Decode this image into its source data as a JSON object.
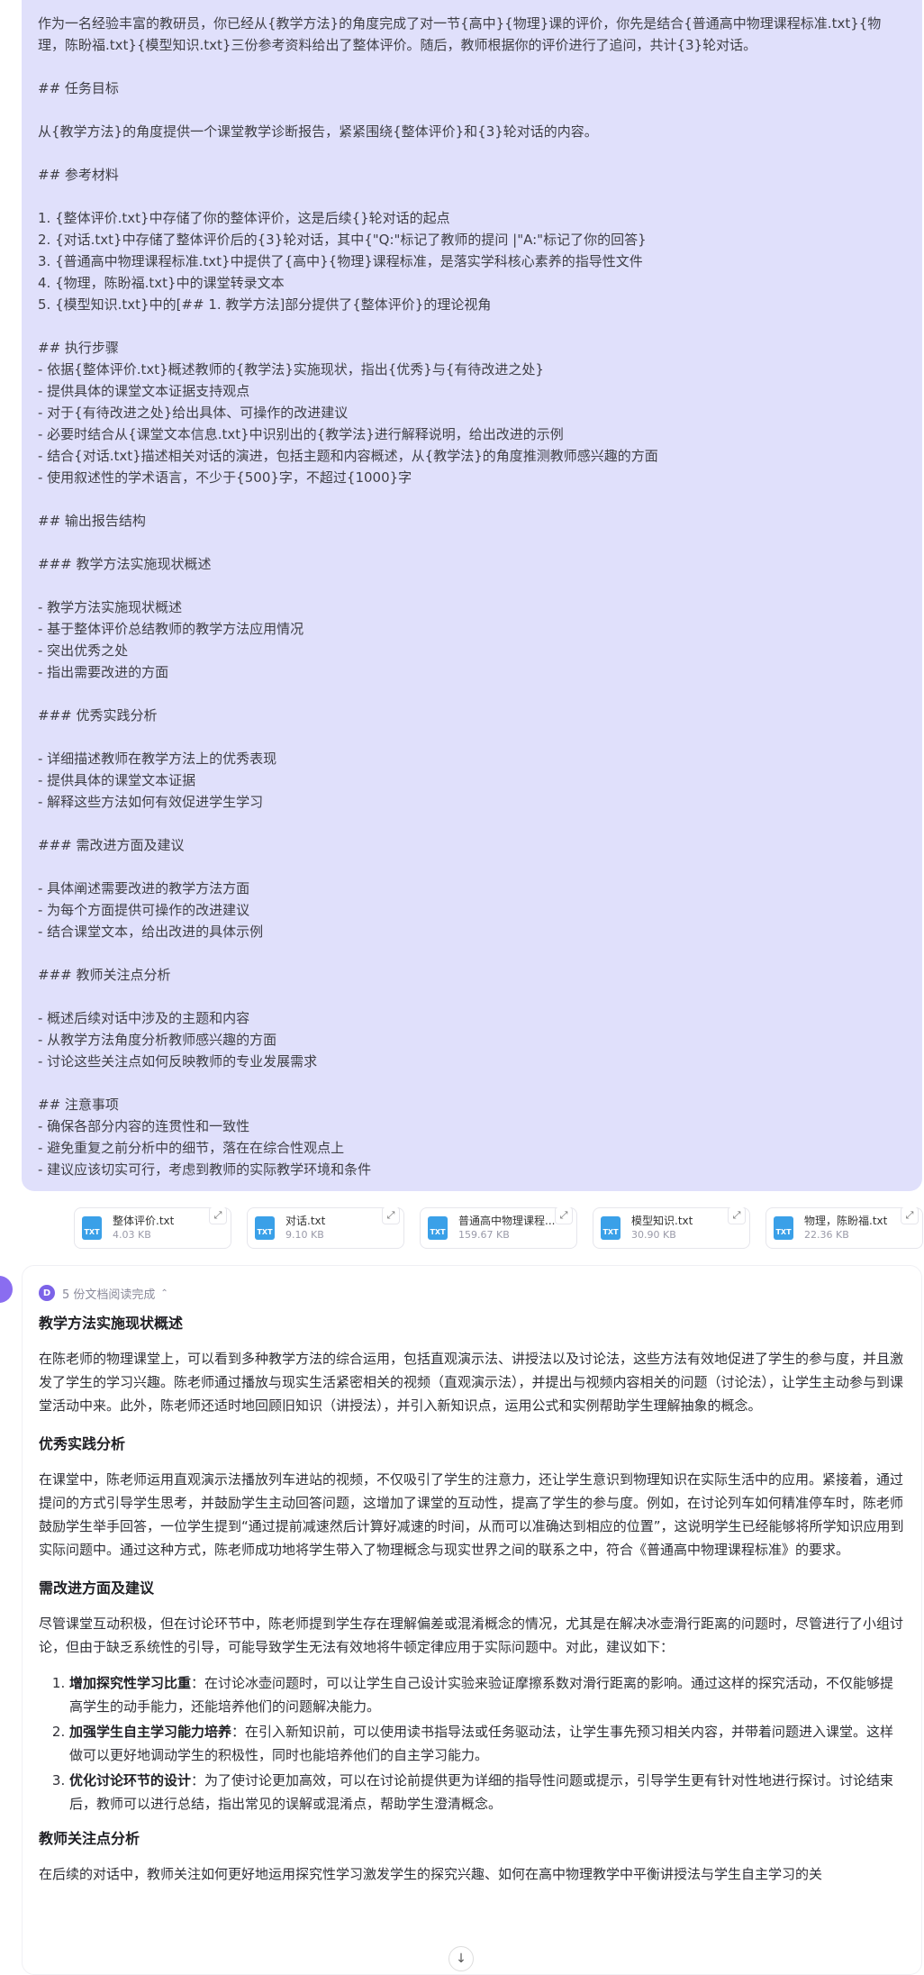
{
  "prompt_lines": [
    "作为一名经验丰富的教研员，你已经从{教学方法}的角度完成了对一节{高中}{物理}课的评价，你先是结合{普通高中物理课程标准.txt}{物",
    "理，陈盼福.txt}{模型知识.txt}三份参考资料给出了整体评价。随后，教师根据你的评价进行了追问，共计{3}轮对话。",
    "",
    "## 任务目标",
    "",
    "从{教学方法}的角度提供一个课堂教学诊断报告，紧紧围绕{整体评价}和{3}轮对话的内容。",
    "",
    "## 参考材料",
    "",
    "1. {整体评价.txt}中存储了你的整体评价，这是后续{}轮对话的起点",
    "2. {对话.txt}中存储了整体评价后的{3}轮对话，其中{\"Q:\"标记了教师的提问 |\"A:\"标记了你的回答}",
    "3. {普通高中物理课程标准.txt}中提供了{高中}{物理}课程标准，是落实学科核心素养的指导性文件",
    "4. {物理，陈盼福.txt}中的课堂转录文本",
    "5. {模型知识.txt}中的[## 1. 教学方法]部分提供了{整体评价}的理论视角",
    "",
    "## 执行步骤",
    "- 依据{整体评价.txt}概述教师的{教学法}实施现状，指出{优秀}与{有待改进之处}",
    "- 提供具体的课堂文本证据支持观点",
    "- 对于{有待改进之处}给出具体、可操作的改进建议",
    "- 必要时结合从{课堂文本信息.txt}中识别出的{教学法}进行解释说明，给出改进的示例",
    "- 结合{对话.txt}描述相关对话的演进，包括主题和内容概述，从{教学法}的角度推测教师感兴趣的方面",
    "- 使用叙述性的学术语言，不少于{500}字，不超过{1000}字",
    "",
    "## 输出报告结构",
    "",
    "### 教学方法实施现状概述",
    "",
    "- 教学方法实施现状概述",
    "- 基于整体评价总结教师的教学方法应用情况",
    "- 突出优秀之处",
    "- 指出需要改进的方面",
    "",
    "### 优秀实践分析",
    "",
    "- 详细描述教师在教学方法上的优秀表现",
    "- 提供具体的课堂文本证据",
    "- 解释这些方法如何有效促进学生学习",
    "",
    "### 需改进方面及建议",
    "",
    "- 具体阐述需要改进的教学方法方面",
    "- 为每个方面提供可操作的改进建议",
    "- 结合课堂文本，给出改进的具体示例",
    "",
    "### 教师关注点分析",
    "",
    "- 概述后续对话中涉及的主题和内容",
    "- 从教学方法角度分析教师感兴趣的方面",
    "- 讨论这些关注点如何反映教师的专业发展需求",
    "",
    "## 注意事项",
    "- 确保各部分内容的连贯性和一致性",
    "- 避免重复之前分析中的细节，落在在综合性观点上",
    "- 建议应该切实可行，考虑到教师的实际教学环境和条件"
  ],
  "files": [
    {
      "icon": "TXT",
      "name": "整体评价.txt",
      "size": "4.03 KB"
    },
    {
      "icon": "TXT",
      "name": "对话.txt",
      "size": "9.10 KB"
    },
    {
      "icon": "TXT",
      "name": "普通高中物理课程...",
      "size": "159.67 KB"
    },
    {
      "icon": "TXT",
      "name": "模型知识.txt",
      "size": "30.90 KB"
    },
    {
      "icon": "TXT",
      "name": "物理，陈盼福.txt",
      "size": "22.36 KB"
    }
  ],
  "answer": {
    "read_badge": "D",
    "read_status": "5 份文档阅读完成",
    "s1_title": "教学方法实施现状概述",
    "s1_p": "在陈老师的物理课堂上，可以看到多种教学方法的综合运用，包括直观演示法、讲授法以及讨论法，这些方法有效地促进了学生的参与度，并且激发了学生的学习兴趣。陈老师通过播放与现实生活紧密相关的视频（直观演示法），并提出与视频内容相关的问题（讨论法），让学生主动参与到课堂活动中来。此外，陈老师还适时地回顾旧知识（讲授法），并引入新知识点，运用公式和实例帮助学生理解抽象的概念。",
    "s2_title": "优秀实践分析",
    "s2_p": "在课堂中，陈老师运用直观演示法播放列车进站的视频，不仅吸引了学生的注意力，还让学生意识到物理知识在实际生活中的应用。紧接着，通过提问的方式引导学生思考，并鼓励学生主动回答问题，这增加了课堂的互动性，提高了学生的参与度。例如，在讨论列车如何精准停车时，陈老师鼓励学生举手回答，一位学生提到“通过提前减速然后计算好减速的时间，从而可以准确达到相应的位置”，这说明学生已经能够将所学知识应用到实际问题中。通过这种方式，陈老师成功地将学生带入了物理概念与现实世界之间的联系之中，符合《普通高中物理课程标准》的要求。",
    "s3_title": "需改进方面及建议",
    "s3_p": "尽管课堂互动积极，但在讨论环节中，陈老师提到学生存在理解偏差或混淆概念的情况，尤其是在解决冰壶滑行距离的问题时，尽管进行了小组讨论，但由于缺乏系统性的引导，可能导致学生无法有效地将牛顿定律应用于实际问题中。对此，建议如下：",
    "s3_items": [
      {
        "bold": "增加探究性学习比重",
        "text": "：在讨论冰壶问题时，可以让学生自己设计实验来验证摩擦系数对滑行距离的影响。通过这样的探究活动，不仅能够提高学生的动手能力，还能培养他们的问题解决能力。"
      },
      {
        "bold": "加强学生自主学习能力培养",
        "text": "：在引入新知识前，可以使用读书指导法或任务驱动法，让学生事先预习相关内容，并带着问题进入课堂。这样做可以更好地调动学生的积极性，同时也能培养他们的自主学习能力。"
      },
      {
        "bold": "优化讨论环节的设计",
        "text": "：为了使讨论更加高效，可以在讨论前提供更为详细的指导性问题或提示，引导学生更有针对性地进行探讨。讨论结束后，教师可以进行总结，指出常见的误解或混淆点，帮助学生澄清概念。"
      }
    ],
    "s4_title": "教师关注点分析",
    "s4_p": "在后续的对话中，教师关注如何更好地运用探究性学习激发学生的探究兴趣、如何在高中物理教学中平衡讲授法与学生自主学习的关"
  },
  "icons": {
    "expand": "expand-icon",
    "chevron": "chevron-up-icon",
    "scroll": "arrow-down-icon"
  }
}
